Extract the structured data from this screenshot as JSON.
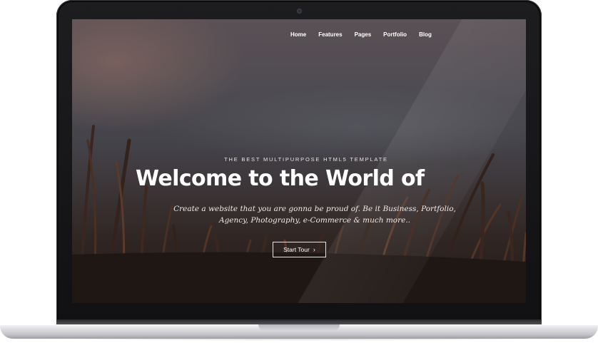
{
  "nav": {
    "items": [
      "Home",
      "Features",
      "Pages",
      "Portfolio",
      "Blog"
    ]
  },
  "hero": {
    "tagline": "THE BEST MULTIPURPOSE HTML5 TEMPLATE",
    "headline": "Welcome to the World of",
    "subline_1": "Create a website that you are gonna be proud of. Be it Business, Portfolio,",
    "subline_2": "Agency, Photography, e-Commerce & much more..",
    "cta_label": "Start Tour",
    "cta_icon": "chevron-right-icon"
  },
  "colors": {
    "text": "#ffffff",
    "bezel": "#151517",
    "aluminium": "#d9d9dd"
  }
}
